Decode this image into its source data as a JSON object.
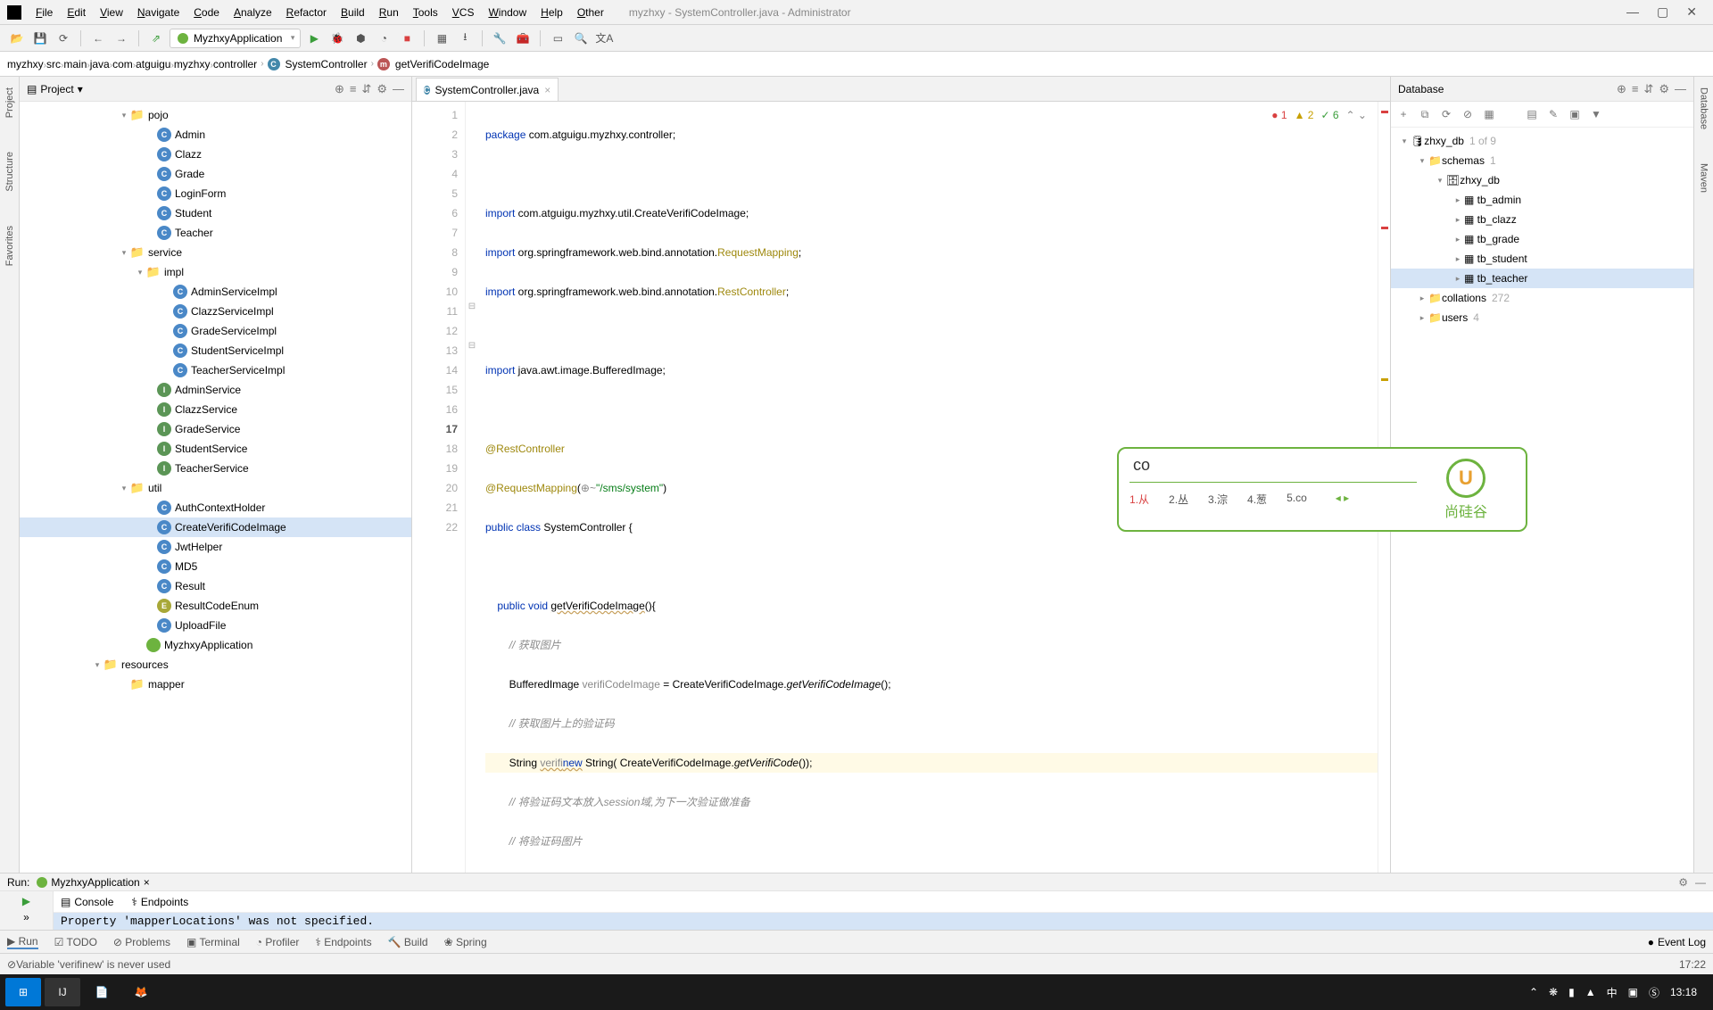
{
  "menu": {
    "items": [
      "File",
      "Edit",
      "View",
      "Navigate",
      "Code",
      "Analyze",
      "Refactor",
      "Build",
      "Run",
      "Tools",
      "VCS",
      "Window",
      "Help",
      "Other"
    ],
    "title": "myzhxy - SystemController.java - Administrator"
  },
  "runConfig": "MyzhxyApplication",
  "breadcrumb": [
    "myzhxy",
    "src",
    "main",
    "java",
    "com",
    "atguigu",
    "myzhxy",
    "controller"
  ],
  "bcClass": "SystemController",
  "bcMethod": "getVerifiCodeImage",
  "projectPanel": {
    "title": "Project"
  },
  "tree": [
    {
      "pad": 110,
      "chev": "▾",
      "ico": "folder",
      "label": "pojo"
    },
    {
      "pad": 140,
      "ico": "cls",
      "ch": "C",
      "label": "Admin"
    },
    {
      "pad": 140,
      "ico": "cls",
      "ch": "C",
      "label": "Clazz"
    },
    {
      "pad": 140,
      "ico": "cls",
      "ch": "C",
      "label": "Grade"
    },
    {
      "pad": 140,
      "ico": "cls",
      "ch": "C",
      "label": "LoginForm"
    },
    {
      "pad": 140,
      "ico": "cls",
      "ch": "C",
      "label": "Student"
    },
    {
      "pad": 140,
      "ico": "cls",
      "ch": "C",
      "label": "Teacher"
    },
    {
      "pad": 110,
      "chev": "▾",
      "ico": "folder",
      "label": "service"
    },
    {
      "pad": 128,
      "chev": "▾",
      "ico": "folder",
      "label": "impl"
    },
    {
      "pad": 158,
      "ico": "cls",
      "ch": "C",
      "label": "AdminServiceImpl"
    },
    {
      "pad": 158,
      "ico": "cls",
      "ch": "C",
      "label": "ClazzServiceImpl"
    },
    {
      "pad": 158,
      "ico": "cls",
      "ch": "C",
      "label": "GradeServiceImpl"
    },
    {
      "pad": 158,
      "ico": "cls",
      "ch": "C",
      "label": "StudentServiceImpl"
    },
    {
      "pad": 158,
      "ico": "cls",
      "ch": "C",
      "label": "TeacherServiceImpl"
    },
    {
      "pad": 140,
      "ico": "intf",
      "ch": "I",
      "label": "AdminService"
    },
    {
      "pad": 140,
      "ico": "intf",
      "ch": "I",
      "label": "ClazzService"
    },
    {
      "pad": 140,
      "ico": "intf",
      "ch": "I",
      "label": "GradeService"
    },
    {
      "pad": 140,
      "ico": "intf",
      "ch": "I",
      "label": "StudentService"
    },
    {
      "pad": 140,
      "ico": "intf",
      "ch": "I",
      "label": "TeacherService"
    },
    {
      "pad": 110,
      "chev": "▾",
      "ico": "folder",
      "label": "util"
    },
    {
      "pad": 140,
      "ico": "cls",
      "ch": "C",
      "label": "AuthContextHolder"
    },
    {
      "pad": 140,
      "ico": "cls",
      "ch": "C",
      "label": "CreateVerifiCodeImage",
      "sel": true
    },
    {
      "pad": 140,
      "ico": "cls",
      "ch": "C",
      "label": "JwtHelper"
    },
    {
      "pad": 140,
      "ico": "cls",
      "ch": "C",
      "label": "MD5"
    },
    {
      "pad": 140,
      "ico": "cls",
      "ch": "C",
      "label": "Result"
    },
    {
      "pad": 140,
      "ico": "enm",
      "ch": "E",
      "label": "ResultCodeEnum"
    },
    {
      "pad": 140,
      "ico": "cls",
      "ch": "C",
      "label": "UploadFile"
    },
    {
      "pad": 128,
      "ico": "spring",
      "ch": "",
      "label": "MyzhxyApplication"
    },
    {
      "pad": 80,
      "chev": "▾",
      "ico": "folder",
      "label": "resources"
    },
    {
      "pad": 110,
      "ico": "folder",
      "label": "mapper"
    }
  ],
  "tabFile": "SystemController.java",
  "lineNums": [
    1,
    2,
    3,
    4,
    5,
    6,
    7,
    8,
    9,
    10,
    11,
    12,
    13,
    14,
    15,
    16,
    17,
    18,
    19,
    20,
    21,
    22
  ],
  "code": {
    "l1_pkg": "package",
    "l1_rest": " com.atguigu.myzhxy.controller;",
    "l3_imp": "import",
    "l3_rest": " com.atguigu.myzhxy.util.CreateVerifiCodeImage;",
    "l4_imp": "import",
    "l4_a": " org.springframework.web.bind.annotation.",
    "l4_b": "RequestMapping",
    "l4_c": ";",
    "l5_imp": "import",
    "l5_a": " org.springframework.web.bind.annotation.",
    "l5_b": "RestController",
    "l5_c": ";",
    "l7_imp": "import",
    "l7_rest": " java.awt.image.BufferedImage;",
    "l9": "@RestController",
    "l10_a": "@RequestMapping",
    "l10_b": "(",
    "l10_c": "⊕~",
    "l10_d": "\"/sms/system\"",
    "l10_e": ")",
    "l11_a": "public class ",
    "l11_b": "SystemController ",
    "l11_c": "{",
    "l13_a": "    public void ",
    "l13_b": "getVerifiCodeImage",
    "l13_c": "(){",
    "l14": "        // 获取图片",
    "l15_a": "        BufferedImage ",
    "l15_b": "verifiCodeImage",
    "l15_c": " = CreateVerifiCodeImage.",
    "l15_d": "getVerifiCodeImage",
    "l15_e": "();",
    "l16": "        // 获取图片上的验证码",
    "l17_a": "        String ",
    "l17_b": "verifi",
    "l17_c": "new",
    "l17_d": " String( CreateVerifiCodeImage.",
    "l17_e": "getVerifiCode",
    "l17_f": "());",
    "l18": "        // 将验证码文本放入session域,为下一次验证做准备",
    "l19": "        // 将验证码图片",
    "l20": "    }",
    "l21": "}"
  },
  "errOverlay": {
    "err": "1",
    "warn": "2",
    "ok": "6"
  },
  "ime": {
    "input": "co",
    "cands": [
      "1.从",
      "2.丛",
      "3.淙",
      "4.葱",
      "5.co"
    ],
    "logoChar": "U",
    "logoText": "尚硅谷"
  },
  "db": {
    "title": "Database",
    "root": "zhxy_db",
    "rootHint": "1 of 9",
    "schemas": "schemas",
    "schemasHint": "1",
    "db": "zhxy_db",
    "tables": [
      "tb_admin",
      "tb_clazz",
      "tb_grade",
      "tb_student",
      "tb_teacher"
    ],
    "collations": "collations",
    "collationsHint": "272",
    "users": "users",
    "usersHint": "4"
  },
  "run": {
    "title": "Run:",
    "conf": "MyzhxyApplication",
    "tabs": [
      "Console",
      "Endpoints"
    ],
    "output": "Property 'mapperLocations' was not specified."
  },
  "bottomTabs": [
    "Run",
    "TODO",
    "Problems",
    "Terminal",
    "Profiler",
    "Endpoints",
    "Build",
    "Spring"
  ],
  "eventLog": "Event Log",
  "status": {
    "left": "Variable 'verifinew' is never used",
    "right": "17:22"
  },
  "tray": {
    "time": "13:18"
  }
}
